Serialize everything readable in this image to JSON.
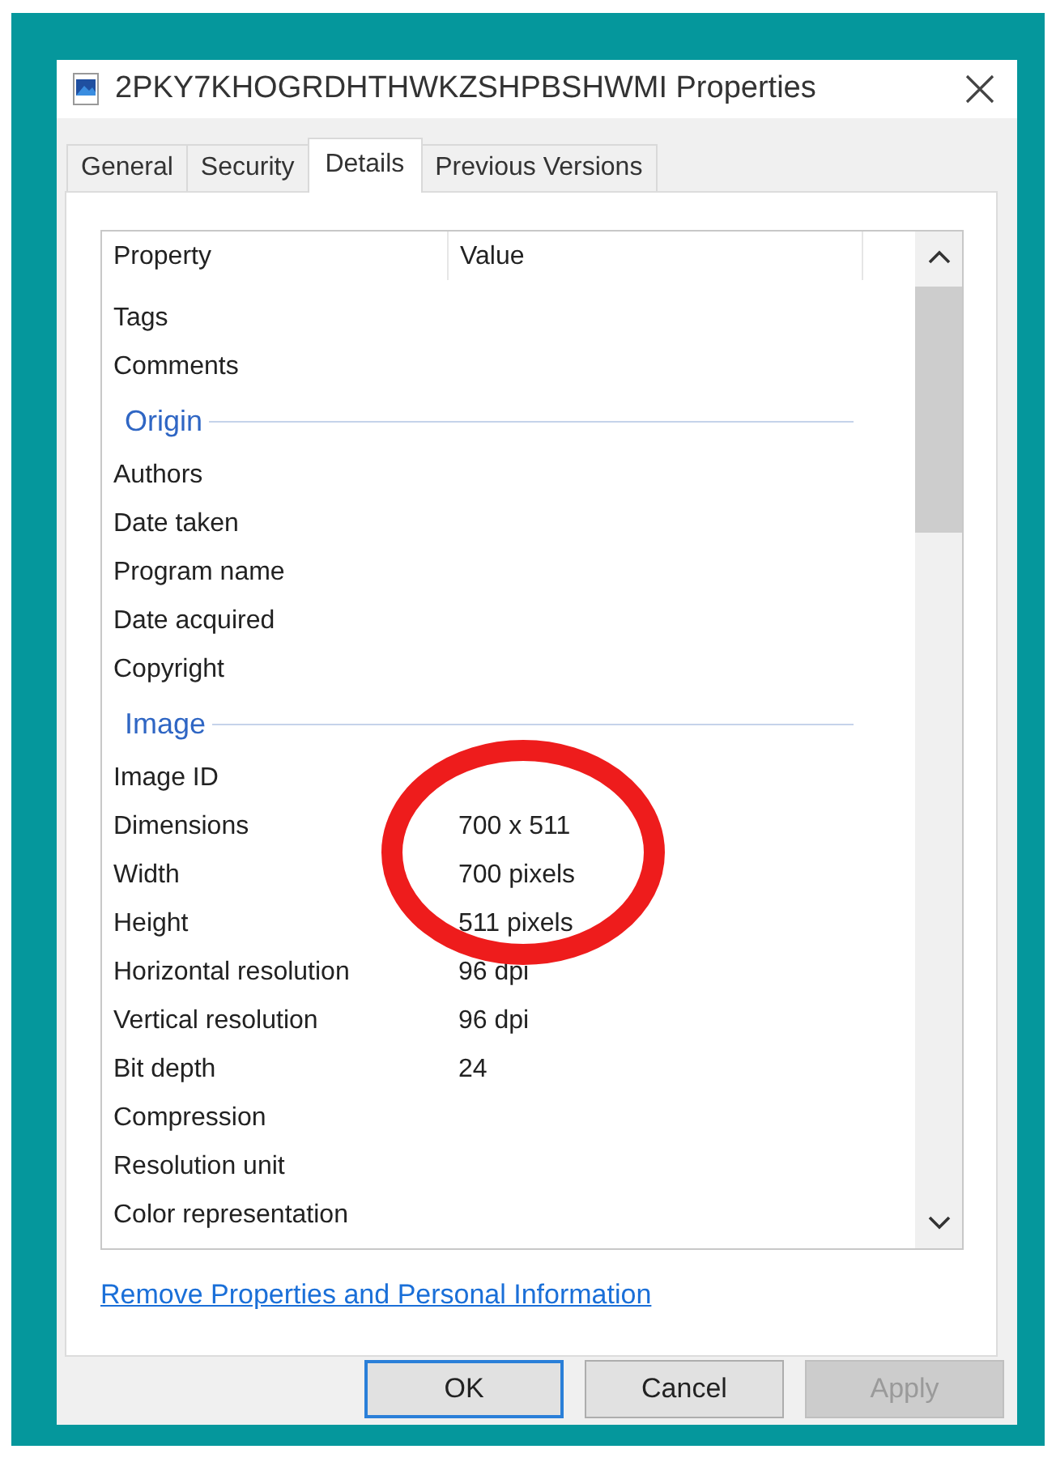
{
  "window": {
    "title": "2PKY7KHOGRDHTHWKZSHPBSHWMI Properties"
  },
  "tabs": [
    {
      "label": "General",
      "selected": false
    },
    {
      "label": "Security",
      "selected": false
    },
    {
      "label": "Details",
      "selected": true
    },
    {
      "label": "Previous Versions",
      "selected": false
    }
  ],
  "table": {
    "columns": [
      "Property",
      "Value"
    ],
    "rows": [
      {
        "kind": "property",
        "name": "Tags"
      },
      {
        "kind": "property",
        "name": "Comments"
      },
      {
        "kind": "group",
        "name": "Origin"
      },
      {
        "kind": "property",
        "name": "Authors"
      },
      {
        "kind": "property",
        "name": "Date taken"
      },
      {
        "kind": "property",
        "name": "Program name"
      },
      {
        "kind": "property",
        "name": "Date acquired"
      },
      {
        "kind": "property",
        "name": "Copyright"
      },
      {
        "kind": "group",
        "name": "Image"
      },
      {
        "kind": "property",
        "name": "Image ID"
      },
      {
        "kind": "property",
        "name": "Dimensions",
        "value": "700 x 511"
      },
      {
        "kind": "property",
        "name": "Width",
        "value": "700 pixels"
      },
      {
        "kind": "property",
        "name": "Height",
        "value": "511 pixels"
      },
      {
        "kind": "property",
        "name": "Horizontal resolution",
        "value": "96 dpi"
      },
      {
        "kind": "property",
        "name": "Vertical resolution",
        "value": "96 dpi"
      },
      {
        "kind": "property",
        "name": "Bit depth",
        "value": "24"
      },
      {
        "kind": "property",
        "name": "Compression"
      },
      {
        "kind": "property",
        "name": "Resolution unit"
      },
      {
        "kind": "property",
        "name": "Color representation"
      }
    ]
  },
  "link": "Remove Properties and Personal Information",
  "buttons": [
    {
      "label": "OK",
      "kind": "default",
      "disabled": false
    },
    {
      "label": "Cancel",
      "kind": "normal",
      "disabled": false
    },
    {
      "label": "Apply",
      "kind": "normal",
      "disabled": true
    }
  ]
}
